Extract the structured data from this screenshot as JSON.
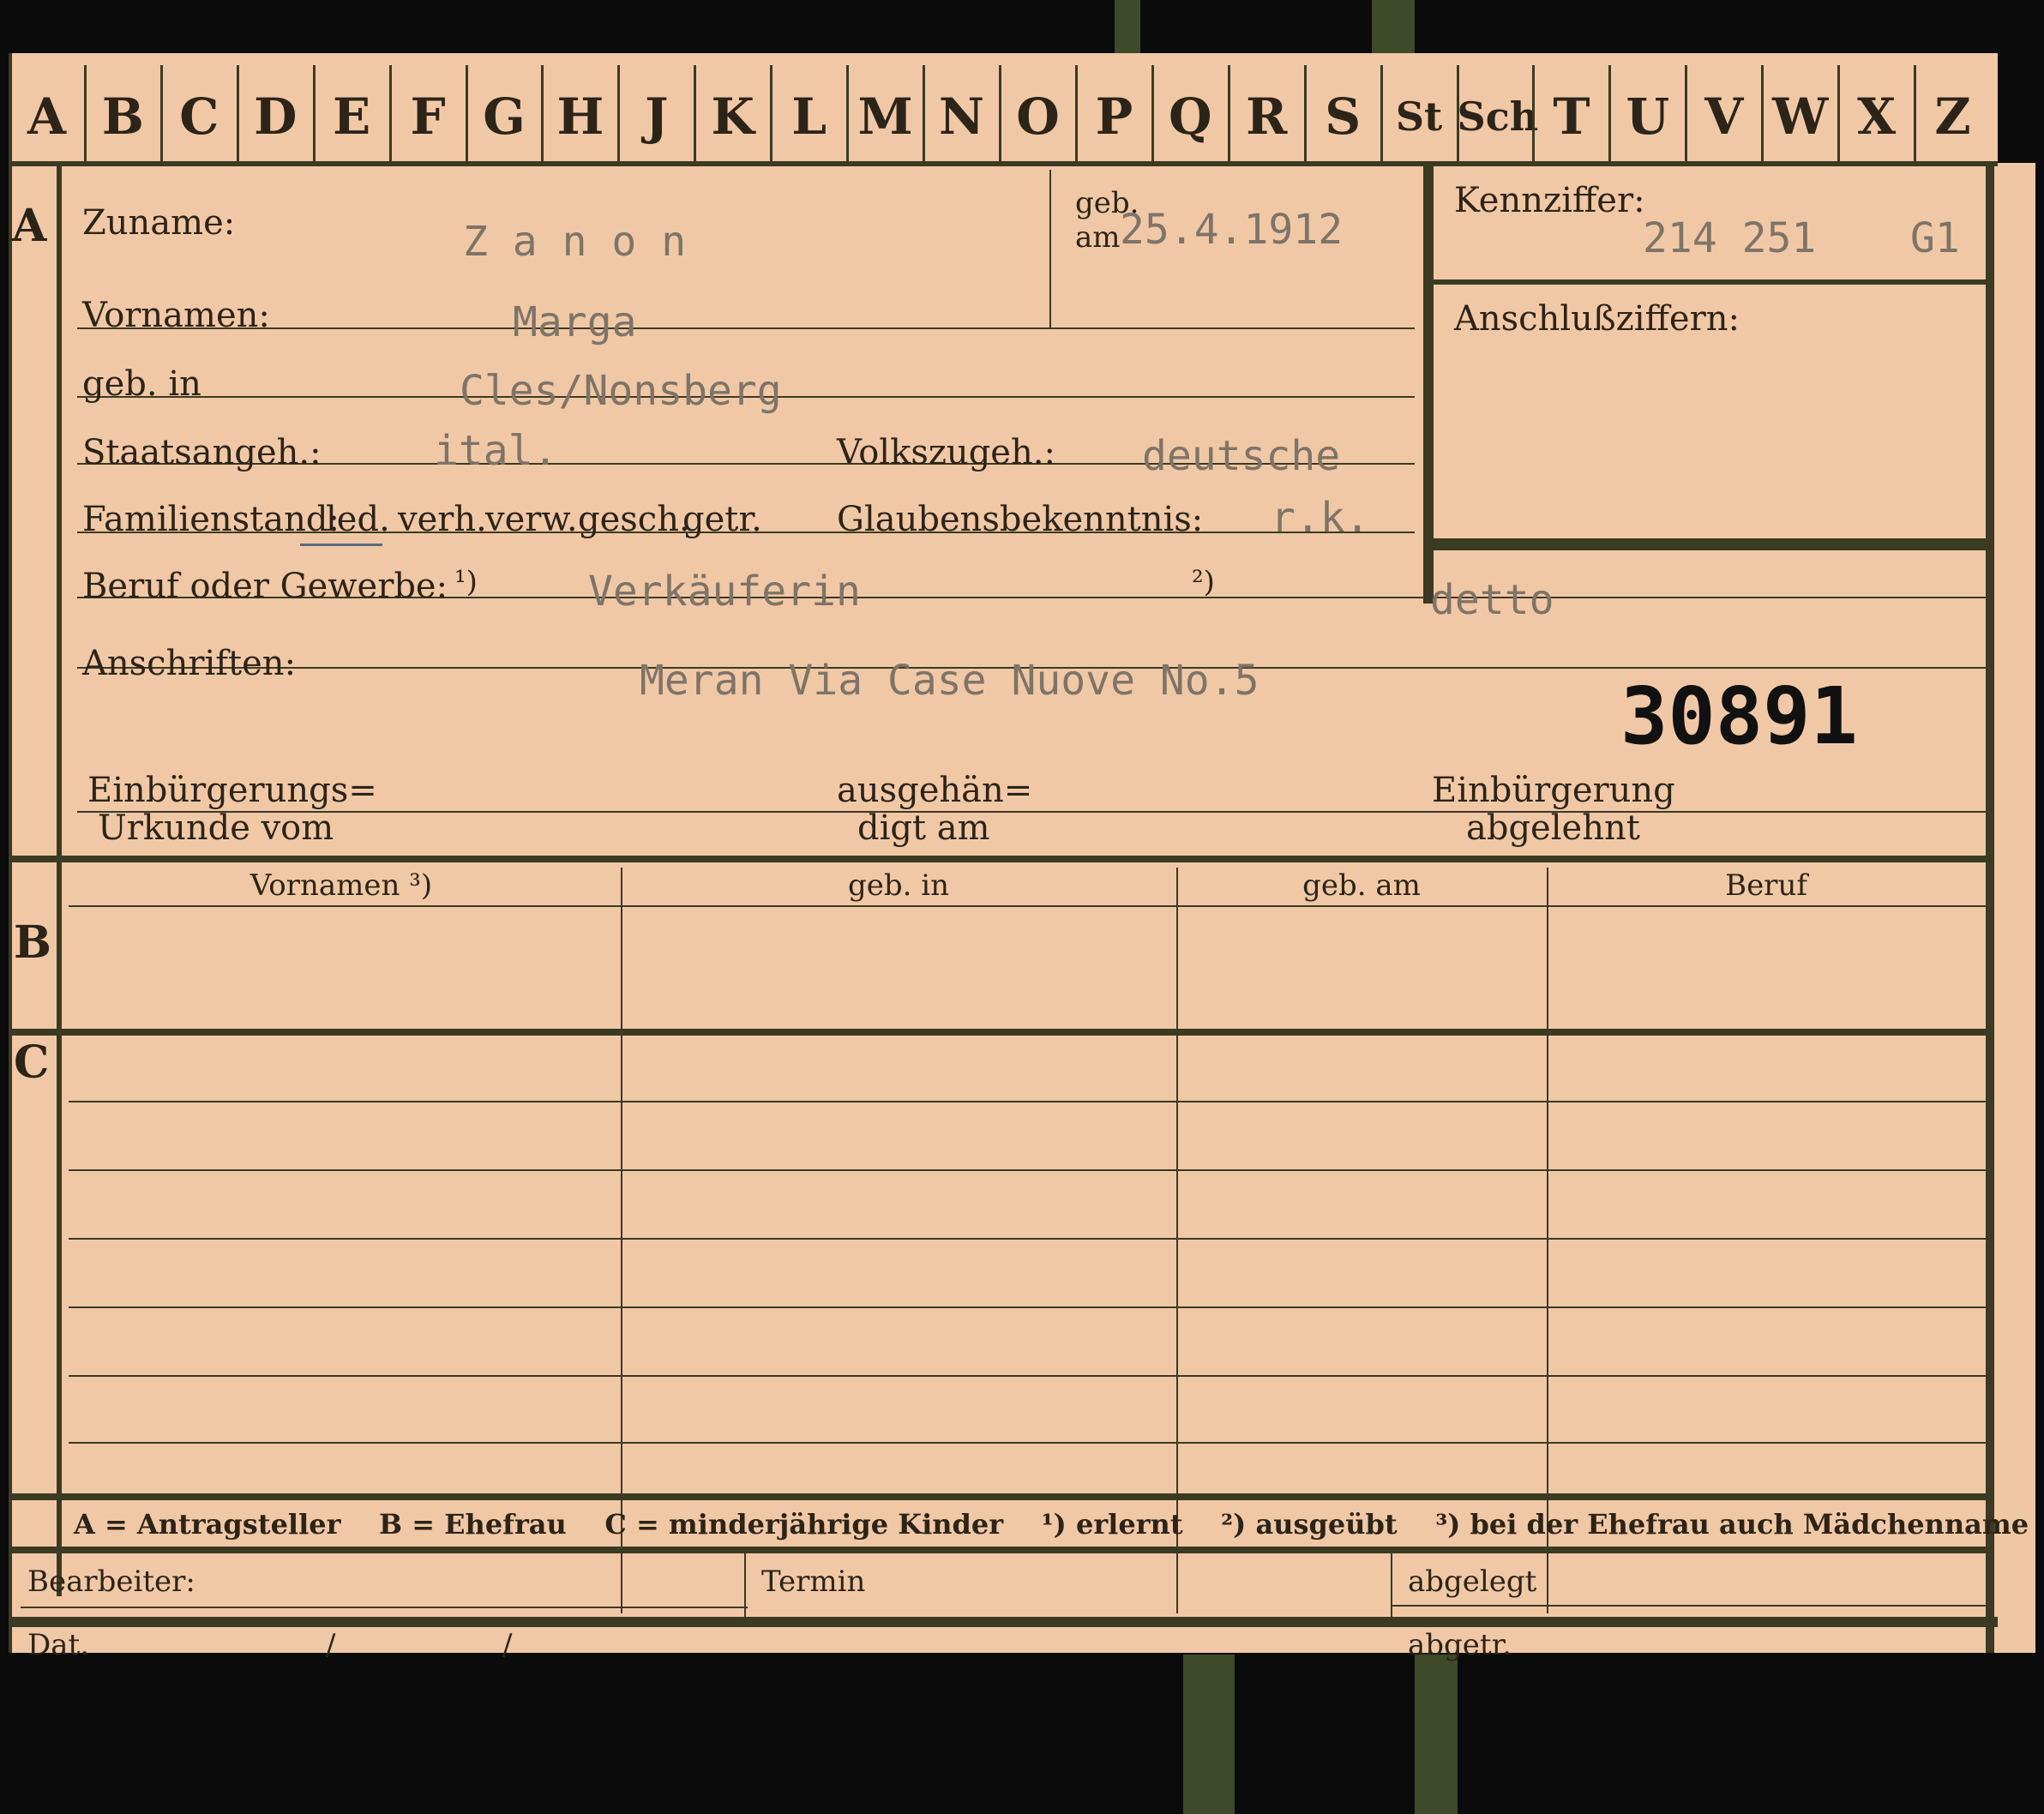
{
  "tabs": [
    "A",
    "B",
    "C",
    "D",
    "E",
    "F",
    "G",
    "H",
    "J",
    "K",
    "L",
    "M",
    "N",
    "O",
    "P",
    "Q",
    "R",
    "S",
    "St",
    "Sch",
    "T",
    "U",
    "V",
    "W",
    "X",
    "Z"
  ],
  "sections": {
    "a": "A",
    "b": "B",
    "c": "C"
  },
  "labels": {
    "zuname": "Zuname:",
    "geb_am": "geb.",
    "geb_am2": "am",
    "kennziffer": "Kennziffer:",
    "anschluss": "Anschlußziffern:",
    "vornamen": "Vornamen:",
    "geb_in": "geb. in",
    "staats": "Staatsangeh.:",
    "volks": "Volkszugeh.:",
    "familien": "Familienstand:",
    "fam_opts": [
      "led.",
      "verh.",
      "verw.",
      "gesch.",
      "getr."
    ],
    "glaubens": "Glaubensbekenntnis:",
    "beruf": "Beruf oder Gewerbe:",
    "note1": "¹)",
    "note2": "²)",
    "anschriften": "Anschriften:",
    "einb1a": "Einbürgerungs=",
    "einb1b": "Urkunde vom",
    "ausg_a": "ausgehän=",
    "ausg_b": "digt am",
    "einb2a": "Einbürgerung",
    "einb2b": "abgelehnt"
  },
  "values": {
    "zuname": "Z a n o n",
    "geb_am": "25.4.1912",
    "kennziffer": "214 251",
    "kennziffer_suffix": "G1",
    "vornamen": "Marga",
    "geb_in": "Cles/Nonsberg",
    "staats": "ital.",
    "volks": "deutsche",
    "glaubens": "r.k.",
    "beruf_erlernt": "Verkäuferin",
    "beruf_ausgeuebt": "detto",
    "anschrift": "Meran Via Case Nuove No.5",
    "stamp_number": "30891"
  },
  "table_headers": [
    "Vornamen ³)",
    "geb. in",
    "geb. am",
    "Beruf"
  ],
  "legend": "A = Antragsteller    B = Ehefrau    C = minderjährige Kinder    ¹) erlernt    ²) ausgeübt    ³) bei der Ehefrau auch Mädchenname",
  "footer": {
    "bearbeiter": "Bearbeiter:",
    "dat": "Dat.",
    "slash": "/",
    "termin": "Termin",
    "abgelegt": "abgelegt",
    "abgetr": "abgetr."
  }
}
